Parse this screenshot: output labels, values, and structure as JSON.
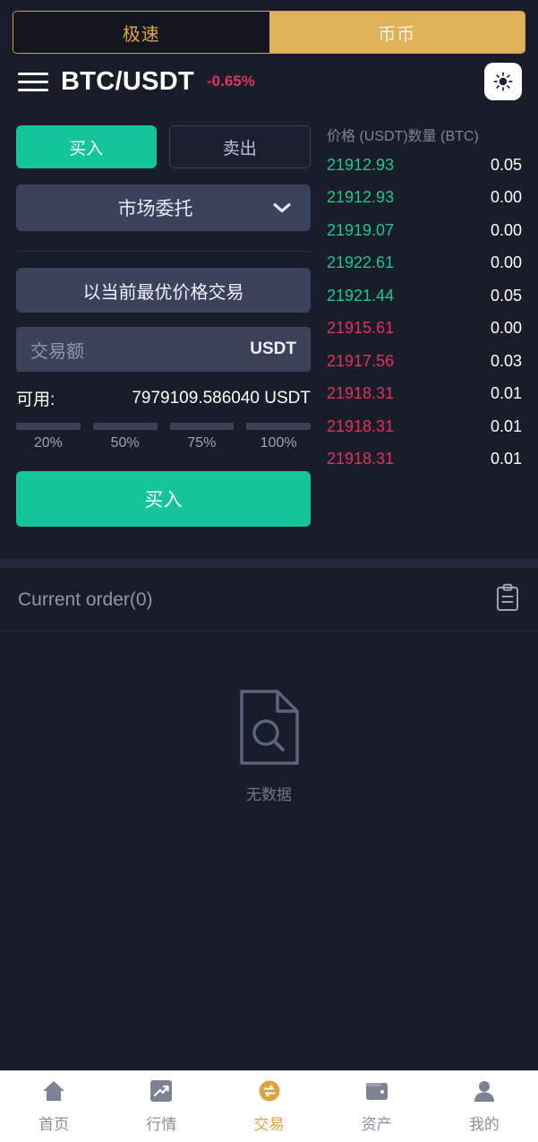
{
  "top_tabs": [
    {
      "label": "极速",
      "active": false,
      "name": "tab-fast"
    },
    {
      "label": "币币",
      "active": true,
      "name": "tab-spot"
    }
  ],
  "header": {
    "menu_icon": "hamburger-icon",
    "pair": "BTC/USDT",
    "change": "-0.65%",
    "change_color": "#e2315a",
    "theme_icon": "sun-icon"
  },
  "trade_form": {
    "side_buy": "买入",
    "side_sell": "卖出",
    "order_type": "市场委托",
    "dropdown_icon": "chevron-down-icon",
    "market_note": "以当前最优价格交易",
    "amount_placeholder": "交易额",
    "amount_value": "",
    "amount_unit": "USDT",
    "available_label": "可用:",
    "available_value": "7979109.586040 USDT",
    "percents": [
      "20%",
      "50%",
      "75%",
      "100%"
    ],
    "submit_label": "买入",
    "buy_color": "#14c49a"
  },
  "orderbook": {
    "header_price": "价格 (USDT)",
    "header_amount": "数量 (BTC)",
    "up_color": "#1ec68f",
    "down_color": "#e2315a",
    "rows": [
      {
        "price": "21912.93",
        "amount": "0.05",
        "dir": "up"
      },
      {
        "price": "21912.93",
        "amount": "0.00",
        "dir": "up"
      },
      {
        "price": "21919.07",
        "amount": "0.00",
        "dir": "up"
      },
      {
        "price": "21922.61",
        "amount": "0.00",
        "dir": "up"
      },
      {
        "price": "21921.44",
        "amount": "0.05",
        "dir": "up"
      },
      {
        "price": "21915.61",
        "amount": "0.00",
        "dir": "down"
      },
      {
        "price": "21917.56",
        "amount": "0.03",
        "dir": "down"
      },
      {
        "price": "21918.31",
        "amount": "0.01",
        "dir": "down"
      },
      {
        "price": "21918.31",
        "amount": "0.01",
        "dir": "down"
      },
      {
        "price": "21918.31",
        "amount": "0.01",
        "dir": "down"
      }
    ]
  },
  "orders_section": {
    "title": "Current order(0)",
    "list_icon": "clipboard-icon",
    "empty_icon": "file-search-icon",
    "empty_text": "无数据"
  },
  "bottom_nav": [
    {
      "label": "首页",
      "icon": "home-icon",
      "active": false
    },
    {
      "label": "行情",
      "icon": "chart-icon",
      "active": false
    },
    {
      "label": "交易",
      "icon": "swap-icon",
      "active": true
    },
    {
      "label": "资产",
      "icon": "wallet-icon",
      "active": false
    },
    {
      "label": "我的",
      "icon": "person-icon",
      "active": false
    }
  ]
}
